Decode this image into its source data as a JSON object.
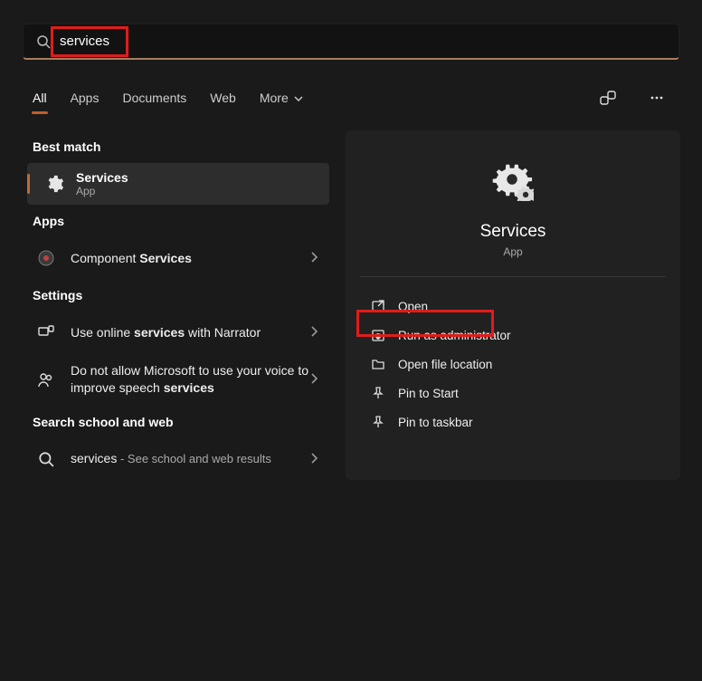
{
  "search": {
    "value": "services"
  },
  "tabs": {
    "all": "All",
    "apps": "Apps",
    "documents": "Documents",
    "web": "Web",
    "more": "More"
  },
  "sections": {
    "best_match": "Best match",
    "apps": "Apps",
    "settings": "Settings",
    "school_web": "Search school and web"
  },
  "best_match": {
    "title": "Services",
    "subtitle": "App"
  },
  "apps_list": {
    "item0_prefix": "Component ",
    "item0_bold": "Services"
  },
  "settings_list": {
    "item0_prefix": "Use online ",
    "item0_bold": "services",
    "item0_suffix": " with Narrator",
    "item1_prefix": "Do not allow Microsoft to use your voice to improve speech ",
    "item1_bold": "services"
  },
  "web_list": {
    "item0_term": "services",
    "item0_rest": " - See school and web results"
  },
  "preview": {
    "title": "Services",
    "subtitle": "App",
    "actions": {
      "open": "Open",
      "run_admin": "Run as administrator",
      "open_loc": "Open file location",
      "pin_start": "Pin to Start",
      "pin_taskbar": "Pin to taskbar"
    }
  }
}
